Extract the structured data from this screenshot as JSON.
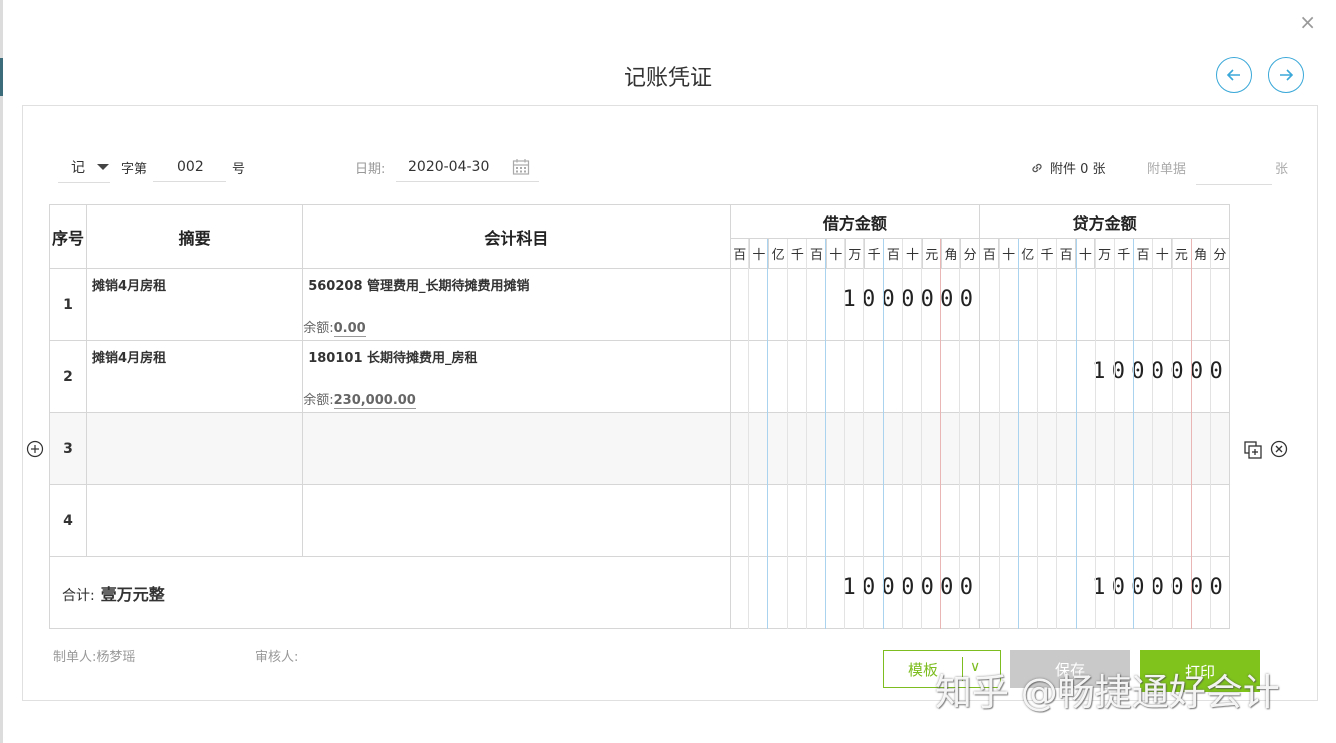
{
  "dialog": {
    "title": "记账凭证",
    "close_label": "×"
  },
  "header": {
    "word_value": "记",
    "word_suffix": "字第",
    "number": "002",
    "number_suffix": "号",
    "date_label": "日期:",
    "date_value": "2020-04-30",
    "attachment_text": "附件 0 张",
    "attach_doc_label": "附单据",
    "attach_doc_unit": "张"
  },
  "table": {
    "columns": {
      "seq": "序号",
      "summary": "摘要",
      "subject": "会计科目",
      "debit": "借方金额",
      "credit": "贷方金额"
    },
    "digit_units": [
      "百",
      "十",
      "亿",
      "千",
      "百",
      "十",
      "万",
      "千",
      "百",
      "十",
      "元",
      "角",
      "分"
    ],
    "rows": [
      {
        "seq": "1",
        "summary": "摊销4月房租",
        "subject": "560208 管理费用_长期待摊费用摊销",
        "balance_label": "余额:",
        "balance": "0.00",
        "debit": "1000000",
        "credit": ""
      },
      {
        "seq": "2",
        "summary": "摊销4月房租",
        "subject": "180101 长期待摊费用_房租",
        "balance_label": "余额:",
        "balance": "230,000.00",
        "debit": "",
        "credit": "1000000"
      },
      {
        "seq": "3",
        "summary": "",
        "subject": "",
        "balance_label": "",
        "balance": "",
        "debit": "",
        "credit": ""
      },
      {
        "seq": "4",
        "summary": "",
        "subject": "",
        "balance_label": "",
        "balance": "",
        "debit": "",
        "credit": ""
      }
    ],
    "total": {
      "label": "合计:",
      "amount_words": "壹万元整",
      "debit": "1000000",
      "credit": "1000000"
    }
  },
  "footer": {
    "maker_label": "制单人:",
    "maker": "杨梦瑶",
    "reviewer_label": "审核人:"
  },
  "buttons": {
    "template": "模板",
    "template_arrow": "∨",
    "save": "保存",
    "print": "打印"
  },
  "watermark": "知乎 @畅捷通好会计",
  "colors": {
    "accent_blue": "#3aa8d8",
    "accent_green": "#7fc31c",
    "save_gray": "#c9c9c9"
  }
}
